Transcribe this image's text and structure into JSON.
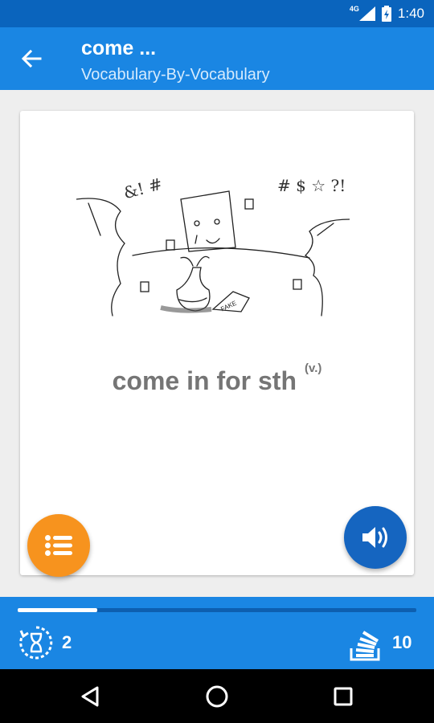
{
  "status_bar": {
    "network": "4G",
    "time": "1:40"
  },
  "header": {
    "title": "come ...",
    "subtitle": "Vocabulary-By-Vocabulary"
  },
  "card": {
    "word": "come in for sth",
    "part_of_speech": "(v.)",
    "illustration_text": {
      "fake_sign": "FAKE",
      "curse_left": "&! #",
      "curse_right": "# $ ☆ ?!"
    }
  },
  "progress": {
    "fraction": 0.2
  },
  "footer": {
    "left_count": "2",
    "right_count": "10"
  },
  "icons": {
    "back": "arrow-back-icon",
    "list": "list-icon",
    "sound": "volume-icon",
    "timer": "hourglass-icon",
    "stack": "card-stack-icon",
    "nav_back": "triangle-back-icon",
    "nav_home": "circle-home-icon",
    "nav_recent": "square-recent-icon"
  },
  "colors": {
    "primary": "#1a86e3",
    "status_bar": "#0a64bd",
    "accent_orange": "#f7931e",
    "accent_blue": "#1565c0"
  }
}
